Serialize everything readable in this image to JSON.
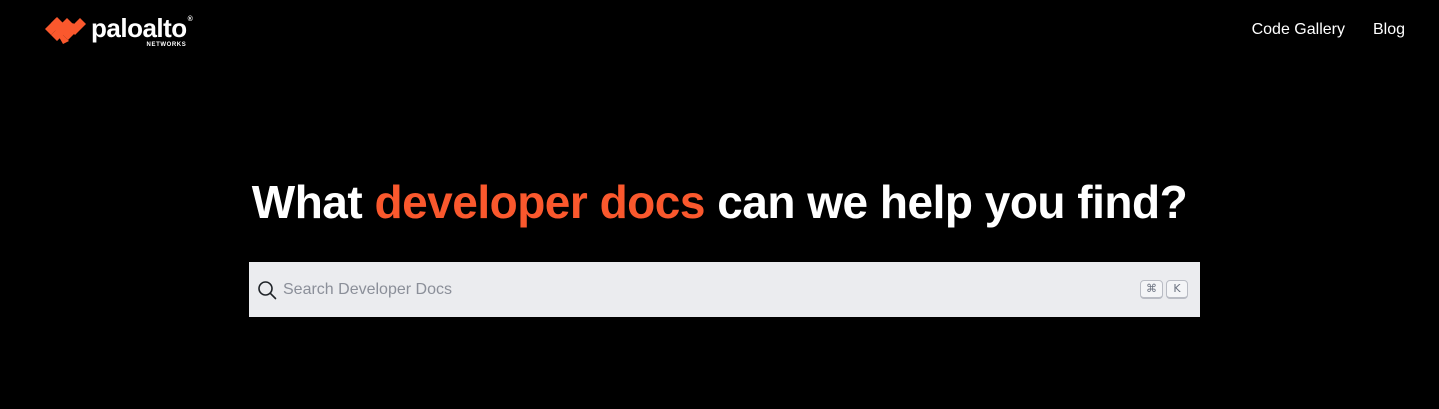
{
  "brand": {
    "name": "paloalto",
    "registered": "®",
    "subtitle": "NETWORKS",
    "accent_color": "#fa582d"
  },
  "nav": {
    "items": [
      {
        "label": "Code Gallery"
      },
      {
        "label": "Blog"
      }
    ]
  },
  "hero": {
    "title_before": "What ",
    "title_accent": "developer docs",
    "title_after": " can we help you find?"
  },
  "search": {
    "placeholder": "Search Developer Docs",
    "value": "",
    "icon": "search-icon",
    "shortcut_keys": [
      "⌘",
      "K"
    ]
  },
  "colors": {
    "background": "#000000",
    "search_background": "#ebecef",
    "text": "#ffffff"
  }
}
